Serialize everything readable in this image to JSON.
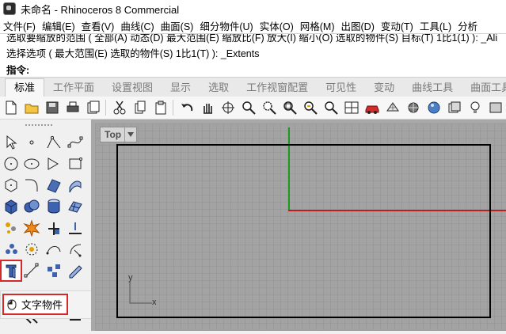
{
  "window": {
    "title": "未命名 - Rhinoceros 8 Commercial"
  },
  "menu": [
    "文件(F)",
    "编辑(E)",
    "查看(V)",
    "曲线(C)",
    "曲面(S)",
    "细分物件(U)",
    "实体(O)",
    "网格(M)",
    "出图(D)",
    "变动(T)",
    "工具(L)",
    "分析"
  ],
  "history": {
    "line1": "选取要缩放的范围 ( 全部(A) 动态(D) 最大范围(E) 缩放比(F) 放大(I) 缩小(O) 选取的物件(S) 目标(T) 1比1(1) ): _Ali",
    "line2": "选择选项 ( 最大范围(E)  选取的物件(S)  1比1(T) ): _Extents",
    "prompt": "指令:"
  },
  "tabs": [
    "标准",
    "工作平面",
    "设置视图",
    "显示",
    "选取",
    "工作视窗配置",
    "可见性",
    "变动",
    "曲线工具",
    "曲面工具"
  ],
  "active_tab": "标准",
  "viewport": {
    "name": "Top",
    "axis_y": "y",
    "axis_x": "x"
  },
  "flyout": {
    "label": "文字物件"
  },
  "colors": {
    "selection": "#d62828",
    "x_axis": "#b82020",
    "y_axis": "#1b9a1b",
    "viewport_bg": "#a3a3a3"
  }
}
